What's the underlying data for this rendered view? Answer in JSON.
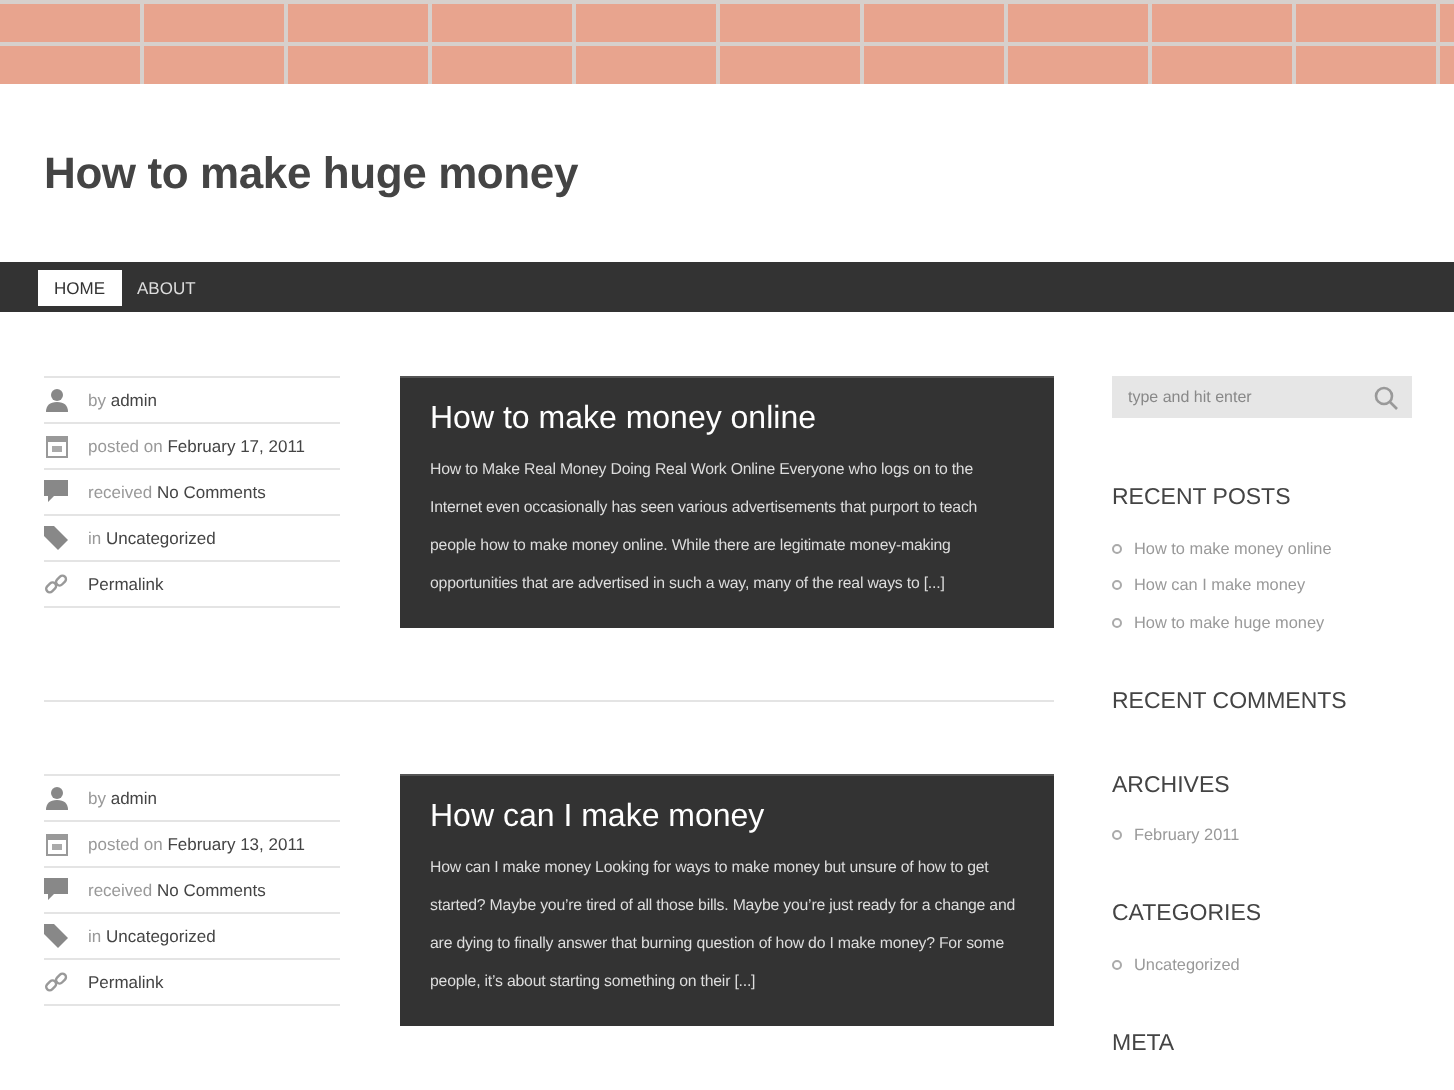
{
  "site": {
    "title": "How to make huge money"
  },
  "nav": [
    {
      "label": "HOME",
      "selected": true
    },
    {
      "label": "ABOUT",
      "selected": false
    }
  ],
  "posts": [
    {
      "meta": [
        {
          "kind": "author",
          "prefix": "by",
          "value": "admin"
        },
        {
          "kind": "date",
          "prefix": "posted on",
          "value": "February 17, 2011"
        },
        {
          "kind": "comments",
          "prefix": "received",
          "value": "No Comments"
        },
        {
          "kind": "category",
          "prefix": "in",
          "value": "Uncategorized"
        },
        {
          "kind": "permalink",
          "value": "Permalink"
        }
      ],
      "title": "How to make money online",
      "excerpt": "How to Make Real Money Doing Real Work Online Everyone who logs on to the Internet even occasionally has seen various advertisements that purport to teach people how to make money online. While there are legitimate money-making opportunities that are advertised in such a way, many of the real ways to [...]"
    },
    {
      "meta": [
        {
          "kind": "author",
          "prefix": "by",
          "value": "admin"
        },
        {
          "kind": "date",
          "prefix": "posted on",
          "value": "February 13, 2011"
        },
        {
          "kind": "comments",
          "prefix": "received",
          "value": "No Comments"
        },
        {
          "kind": "category",
          "prefix": "in",
          "value": "Uncategorized"
        },
        {
          "kind": "permalink",
          "value": "Permalink"
        }
      ],
      "title": "How can I make money",
      "excerpt": "How can I make money Looking for ways to make money but unsure of how to get started? Maybe you’re tired of all those bills. Maybe you’re just ready for a change and are dying to finally answer that burning question of how do I make money? For some people, it’s about starting something on their [...]"
    }
  ],
  "sidebar": {
    "search": {
      "placeholder": "type and hit enter"
    },
    "widgets": [
      {
        "title": "RECENT POSTS",
        "items": [
          "How to make money online",
          "How can I make money",
          "How to make huge money"
        ]
      },
      {
        "title": "RECENT COMMENTS"
      },
      {
        "title": "ARCHIVES",
        "items": [
          "February 2011"
        ]
      },
      {
        "title": "CATEGORIES",
        "items": [
          "Uncategorized"
        ]
      },
      {
        "title": "META"
      }
    ]
  }
}
